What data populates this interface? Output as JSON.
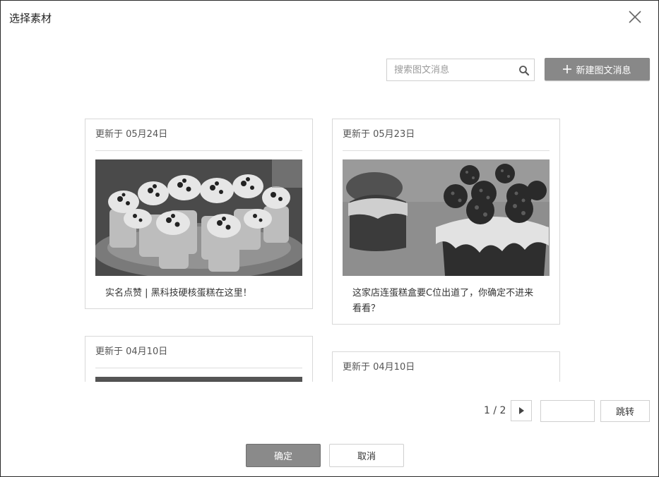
{
  "dialog": {
    "title": "选择素材",
    "close_icon": "close-icon"
  },
  "toolbar": {
    "search_placeholder": "搜索图文消息",
    "search_value": "",
    "search_icon": "search-icon",
    "new_button_label": "新建图文消息",
    "new_button_icon": "plus-icon"
  },
  "articles": [
    {
      "date": "更新于 05月24日",
      "title": "实名点赞 | 黑科技硬核蛋糕在这里！",
      "image": "oreo-dessert-cups-photo"
    },
    {
      "date": "更新于 05月23日",
      "title": "这家店连蛋糕盒要C位出道了，你确定不进来看看？",
      "image": "raspberry-cupcakes-photo"
    },
    {
      "date": "更新于 04月10日",
      "title": "",
      "image": "dessert-photo"
    },
    {
      "date": "更新于 04月10日",
      "title": "",
      "image": ""
    }
  ],
  "pagination": {
    "current_label": "1 / 2",
    "next_icon": "triangle-right-icon",
    "page_input_value": "",
    "jump_label": "跳转"
  },
  "footer": {
    "confirm_label": "确定",
    "cancel_label": "取消"
  },
  "colors": {
    "primary_button": "#888888",
    "border": "#d8d8d8"
  }
}
